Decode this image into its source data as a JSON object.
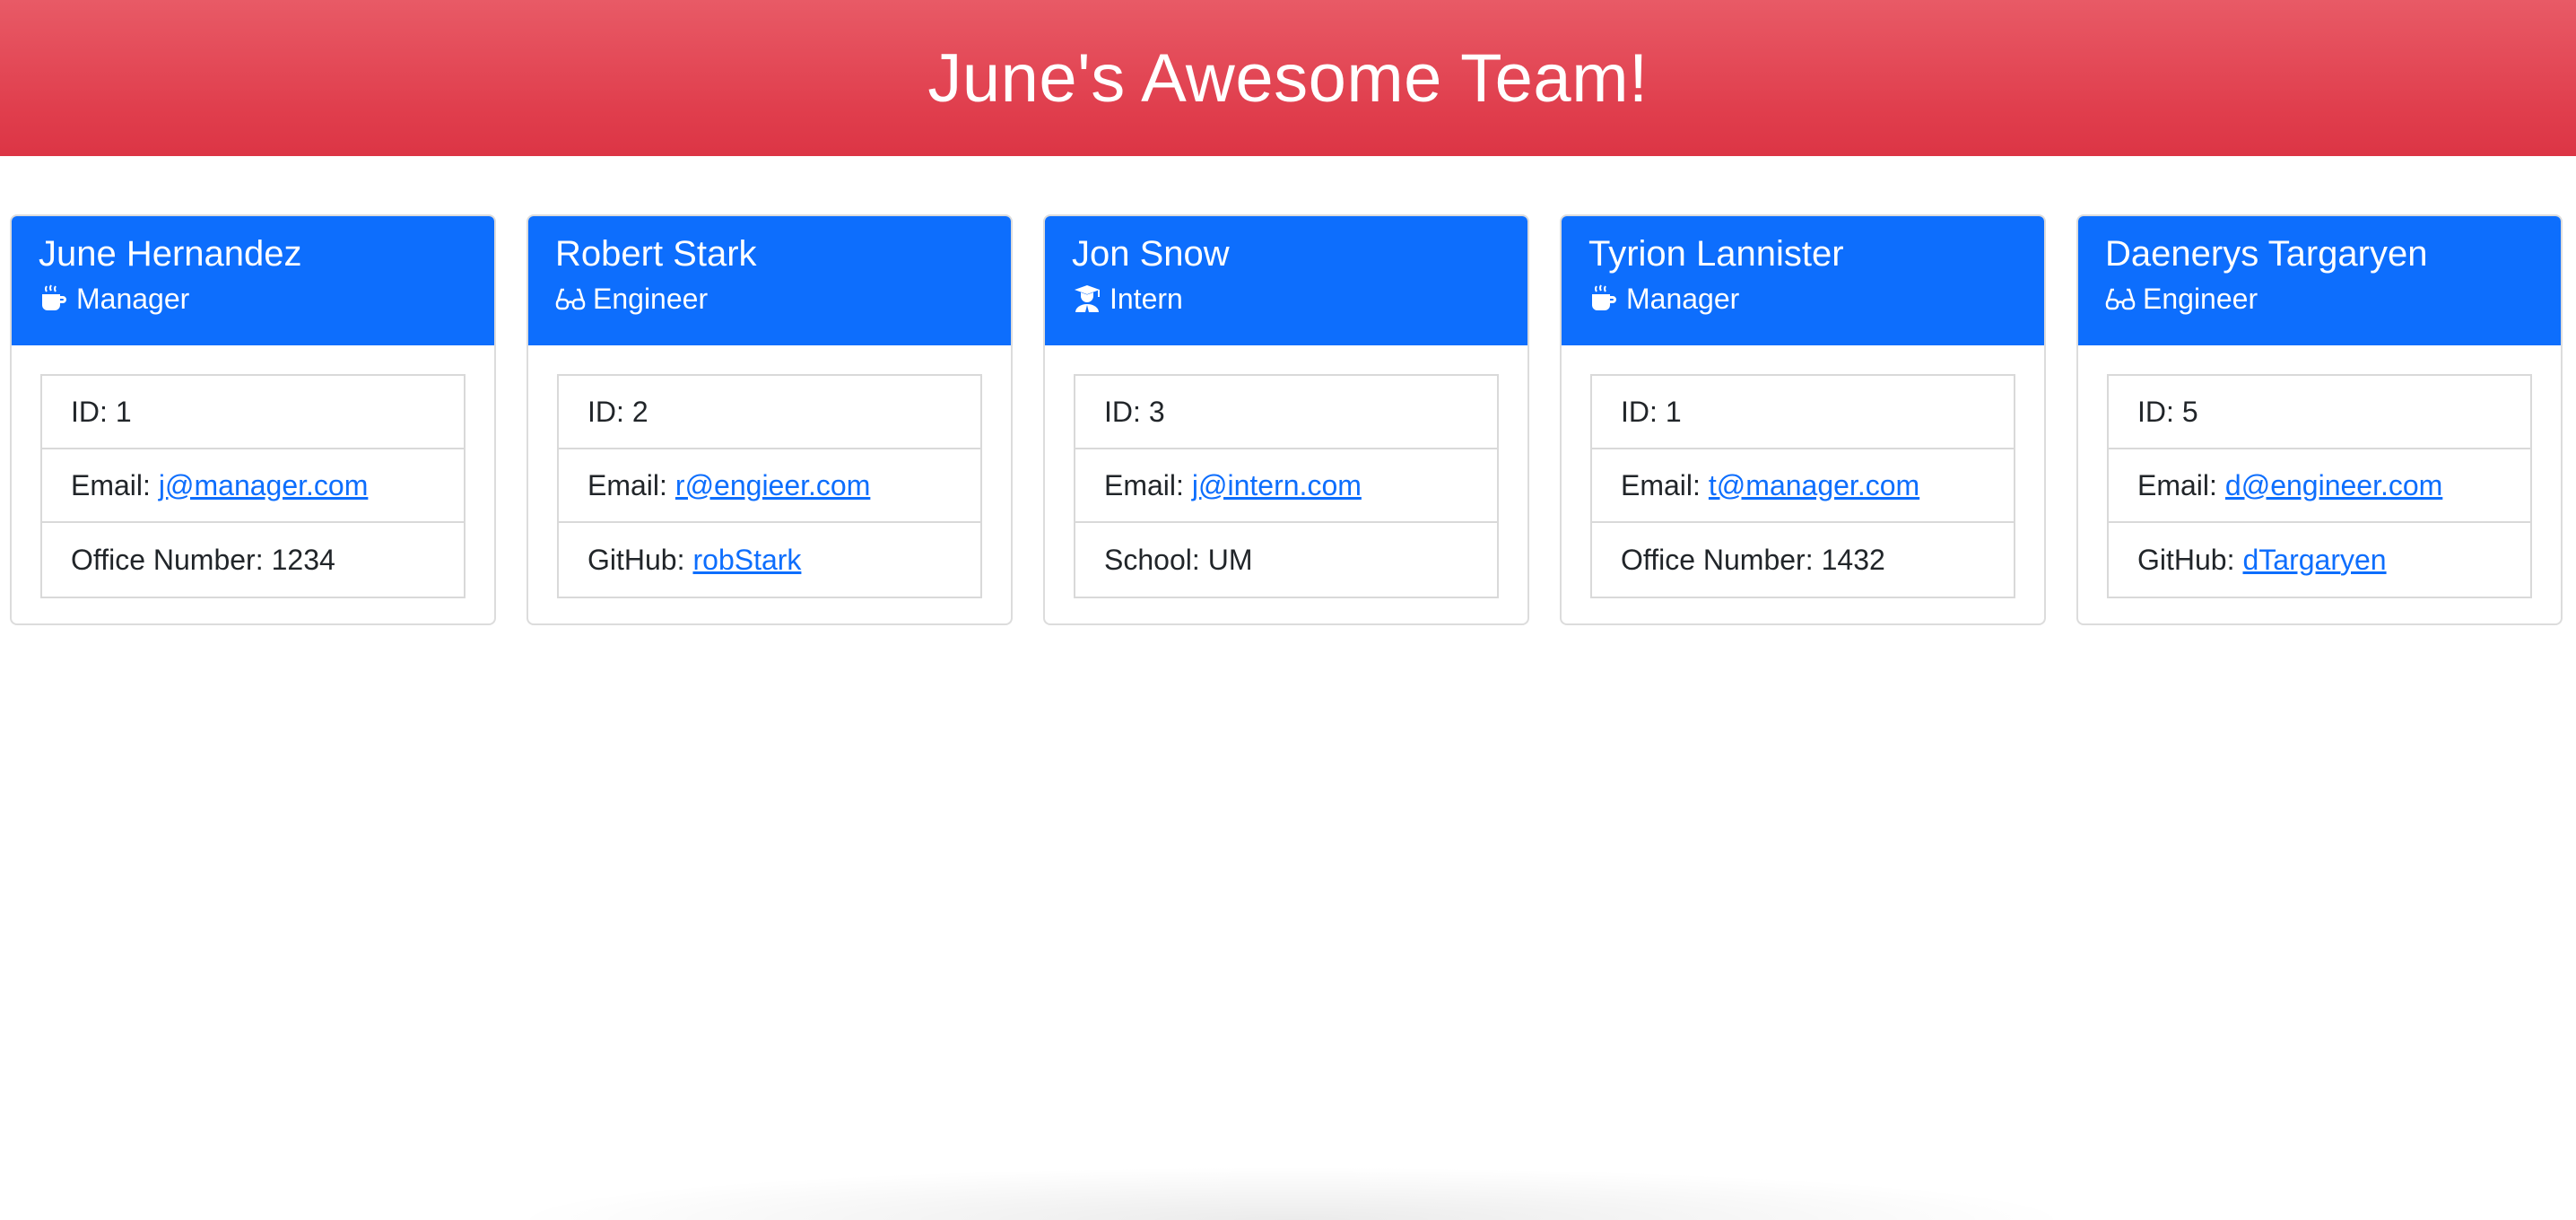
{
  "header": {
    "title": "June's Awesome Team!"
  },
  "colors": {
    "header_red": "#dc3545",
    "card_blue": "#0d6efd",
    "link_blue": "#0d6efd"
  },
  "cards": [
    {
      "name": "June Hernandez",
      "role": "Manager",
      "role_icon": "mug-hot-icon",
      "items": [
        {
          "label": "ID:",
          "value": "1"
        },
        {
          "label": "Email:",
          "value": "j@manager.com"
        },
        {
          "label": "Office Number:",
          "value": "1234"
        }
      ]
    },
    {
      "name": "Robert Stark",
      "role": "Engineer",
      "role_icon": "glasses-icon",
      "items": [
        {
          "label": "ID:",
          "value": "2"
        },
        {
          "label": "Email:",
          "value": "r@engieer.com"
        },
        {
          "label": "GitHub:",
          "value": "robStark"
        }
      ]
    },
    {
      "name": "Jon Snow",
      "role": "Intern",
      "role_icon": "user-graduate-icon",
      "items": [
        {
          "label": "ID:",
          "value": "3"
        },
        {
          "label": "Email:",
          "value": "j@intern.com"
        },
        {
          "label": "School:",
          "value": "UM"
        }
      ]
    },
    {
      "name": "Tyrion Lannister",
      "role": "Manager",
      "role_icon": "mug-hot-icon",
      "items": [
        {
          "label": "ID:",
          "value": "1"
        },
        {
          "label": "Email:",
          "value": "t@manager.com"
        },
        {
          "label": "Office Number:",
          "value": "1432"
        }
      ]
    },
    {
      "name": "Daenerys Targaryen",
      "role": "Engineer",
      "role_icon": "glasses-icon",
      "items": [
        {
          "label": "ID:",
          "value": "5"
        },
        {
          "label": "Email:",
          "value": "d@engineer.com"
        },
        {
          "label": "GitHub:",
          "value": "dTargaryen"
        }
      ]
    }
  ]
}
